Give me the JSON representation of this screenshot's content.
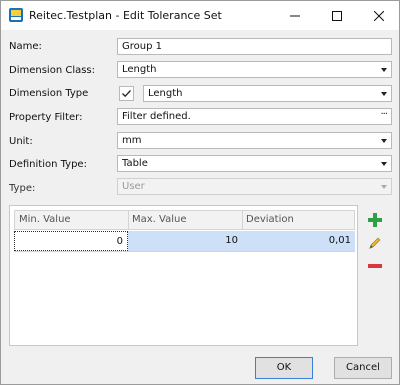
{
  "window": {
    "title": "Reitec.Testplan - Edit Tolerance Set"
  },
  "form": {
    "name": {
      "label": "Name:",
      "value": "Group 1"
    },
    "dimension_class": {
      "label": "Dimension Class:",
      "value": "Length"
    },
    "dimension_type": {
      "label": "Dimension Type",
      "checked": true,
      "value": "Length"
    },
    "property_filter": {
      "label": "Property Filter:",
      "value": "Filter defined.",
      "button": "···"
    },
    "unit": {
      "label": "Unit:",
      "value": "mm"
    },
    "definition_type": {
      "label": "Definition Type:",
      "value": "Table"
    },
    "type": {
      "label": "Type:",
      "value": "User",
      "disabled": true
    }
  },
  "grid": {
    "columns": [
      "Min. Value",
      "Max. Value",
      "Deviation"
    ],
    "rows": [
      {
        "min": "0",
        "max": "10",
        "deviation": "0,01"
      }
    ]
  },
  "side_buttons": {
    "add": "add-icon",
    "edit": "pencil-icon",
    "remove": "minus-icon"
  },
  "buttons": {
    "ok": "OK",
    "cancel": "Cancel"
  },
  "colors": {
    "selected_row": "#cde0f7",
    "add": "#2ea043",
    "remove": "#d9363e",
    "edit": "#e8b830"
  }
}
